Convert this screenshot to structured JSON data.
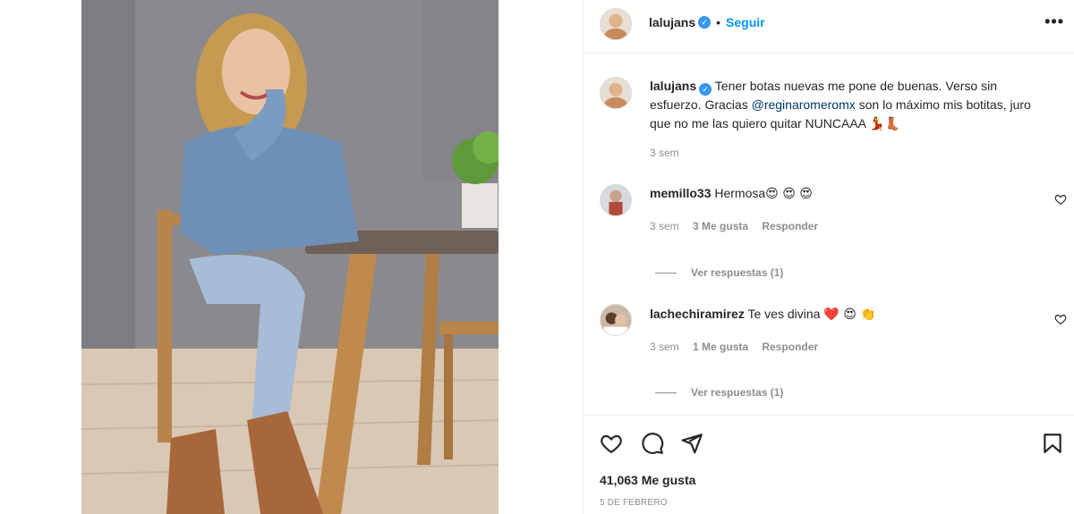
{
  "post": {
    "username": "lalujans",
    "verified": true,
    "follow_label": "Seguir",
    "more_icon": "ellipsis-icon"
  },
  "caption": {
    "username": "lalujans",
    "text_part1": "Tener botas nuevas me pone de buenas. Verso sin esfuerzo. Gracias ",
    "mention": "@reginaromeromx",
    "text_part2": " son lo máximo mis botitas, juro que no me las quiero quitar NUNCAAA",
    "emojis": "💃👢",
    "time": "3 sem"
  },
  "comments": [
    {
      "username": "memillo33",
      "text": "Hermosa",
      "emojis": "😍 😍 😍",
      "time": "3 sem",
      "likes": "3 Me gusta",
      "reply_label": "Responder",
      "view_replies": "Ver respuestas (1)"
    },
    {
      "username": "lachechiramirez",
      "text": "Te ves divina",
      "emojis": "❤️ 😍 👏",
      "time": "3 sem",
      "likes": "1 Me gusta",
      "reply_label": "Responder",
      "view_replies": "Ver respuestas (1)"
    }
  ],
  "footer": {
    "likes_count": "41,063 Me gusta",
    "date": "5 DE FEBRERO"
  },
  "colors": {
    "accent": "#0095f6",
    "verified": "#3897f0",
    "muted": "#8e8e8e",
    "mention": "#00376b"
  }
}
